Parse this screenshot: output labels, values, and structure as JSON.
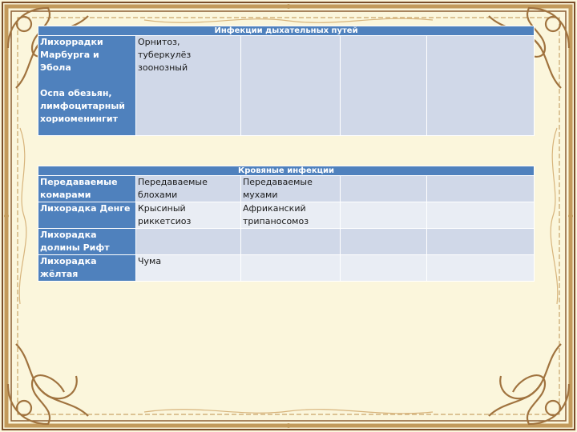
{
  "colors": {
    "background": "#fbf6dc",
    "header_blue": "#4f81bd",
    "row_dark": "#d0d8e8",
    "row_light": "#e9edf4",
    "frame_gold": "#c29a5b",
    "frame_brown": "#7a4f2a"
  },
  "decor": {
    "frame": "ornate-baroque-frame-icon"
  },
  "table1": {
    "title": "Инфекции дыхательных путей",
    "rows": [
      {
        "first": "Лихоррадки\nМарбурга и\nЭбола\n\nОспа обезьян,\nлимфоцитарный\nхориоменингит",
        "cells": [
          "Орнитоз,\nтуберкулёз\nзоонозный",
          "",
          "",
          "",
          ""
        ]
      }
    ]
  },
  "table2": {
    "title": "Кровяные инфекции",
    "rows": [
      {
        "first": "Передаваемые\nкомарами",
        "cells": [
          "Передаваемые\nблохами",
          "Передаваемые\nмухами",
          "",
          ""
        ]
      },
      {
        "first": "Лихорадка Денге",
        "cells": [
          "Крысиный\nриккетсиоз",
          "Африканский\nтрипаносомоз",
          "",
          ""
        ]
      },
      {
        "first": "Лихорадка\nдолины Рифт",
        "cells": [
          "",
          "",
          "",
          ""
        ]
      },
      {
        "first": "Лихорадка\nжёлтая",
        "cells": [
          "Чума",
          "",
          "",
          ""
        ]
      }
    ]
  }
}
